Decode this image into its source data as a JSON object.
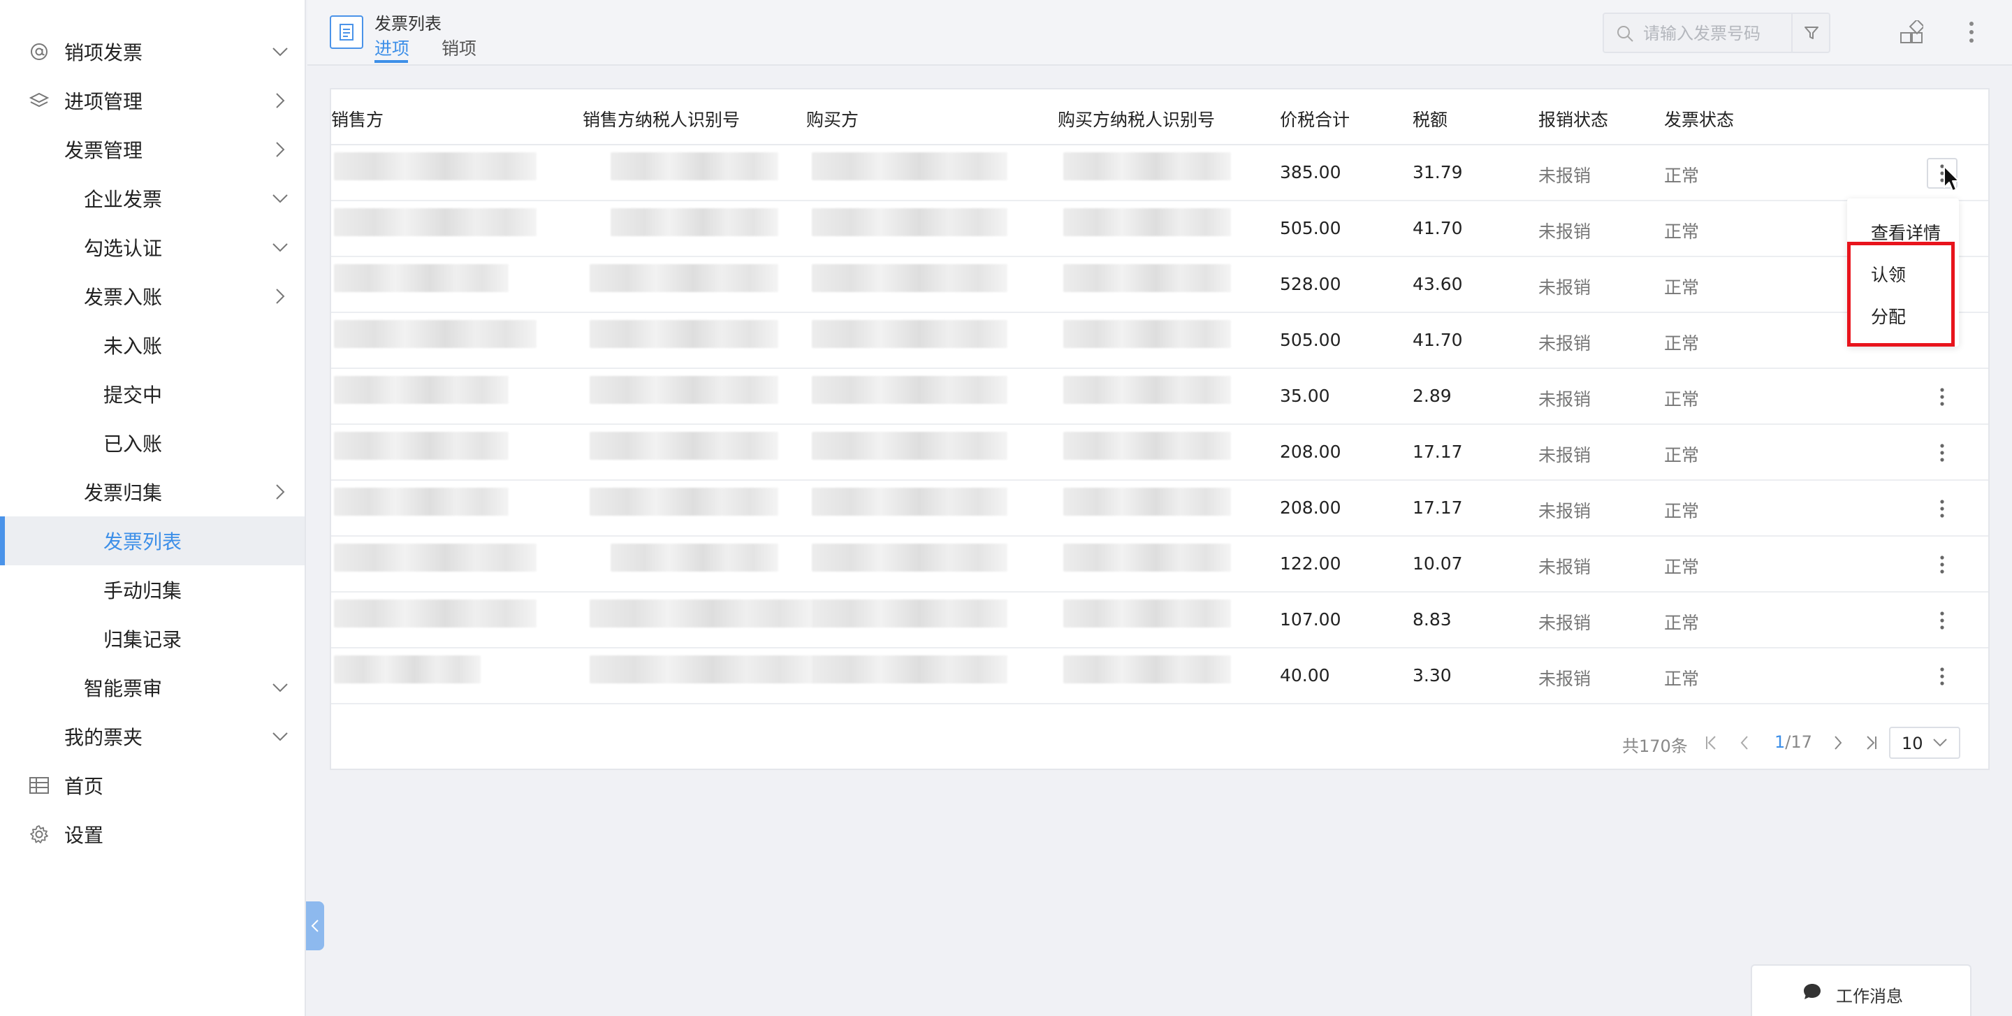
{
  "sidebar": {
    "items": [
      {
        "label": "销项发票",
        "icon": "at-icon",
        "chevron": "down"
      },
      {
        "label": "进项管理",
        "icon": "layers-icon",
        "chevron": "right"
      },
      {
        "label": "发票管理",
        "chevron": "right"
      },
      {
        "label": "企业发票",
        "chevron": "down"
      },
      {
        "label": "勾选认证",
        "chevron": "down"
      },
      {
        "label": "发票入账",
        "chevron": "right"
      },
      {
        "label": "未入账"
      },
      {
        "label": "提交中"
      },
      {
        "label": "已入账"
      },
      {
        "label": "发票归集",
        "chevron": "right"
      },
      {
        "label": "发票列表",
        "active": true
      },
      {
        "label": "手动归集"
      },
      {
        "label": "归集记录"
      },
      {
        "label": "智能票审",
        "chevron": "down"
      },
      {
        "label": "我的票夹",
        "chevron": "down"
      },
      {
        "label": "首页",
        "icon": "table-icon"
      },
      {
        "label": "设置",
        "icon": "gear-icon"
      }
    ]
  },
  "header": {
    "title": "发票列表",
    "tabs": [
      {
        "label": "进项",
        "active": true
      },
      {
        "label": "销项",
        "active": false
      }
    ],
    "search_placeholder": "请输入发票号码"
  },
  "table": {
    "columns": [
      "销售方",
      "销售方纳税人识别号",
      "购买方",
      "购买方纳税人识别号",
      "价税合计",
      "税额",
      "报销状态",
      "发票状态"
    ],
    "rows": [
      {
        "total": "385.00",
        "tax": "31.79",
        "reimburse": "未报销",
        "status": "正常"
      },
      {
        "total": "505.00",
        "tax": "41.70",
        "reimburse": "未报销",
        "status": "正常"
      },
      {
        "total": "528.00",
        "tax": "43.60",
        "reimburse": "未报销",
        "status": "正常"
      },
      {
        "total": "505.00",
        "tax": "41.70",
        "reimburse": "未报销",
        "status": "正常"
      },
      {
        "total": "35.00",
        "tax": "2.89",
        "reimburse": "未报销",
        "status": "正常"
      },
      {
        "total": "208.00",
        "tax": "17.17",
        "reimburse": "未报销",
        "status": "正常"
      },
      {
        "total": "208.00",
        "tax": "17.17",
        "reimburse": "未报销",
        "status": "正常"
      },
      {
        "total": "122.00",
        "tax": "10.07",
        "reimburse": "未报销",
        "status": "正常"
      },
      {
        "total": "107.00",
        "tax": "8.83",
        "reimburse": "未报销",
        "status": "正常"
      },
      {
        "total": "40.00",
        "tax": "3.30",
        "reimburse": "未报销",
        "status": "正常"
      }
    ]
  },
  "row_menu": {
    "items": [
      "查看详情",
      "认领",
      "分配"
    ]
  },
  "pagination": {
    "total": "共170条",
    "current": "1",
    "pages": "/17",
    "page_size": "10"
  },
  "work_message": {
    "label": "工作消息"
  },
  "colors": {
    "accent": "#3d8fe8",
    "highlight": "#e8141c",
    "muted_text": "#777777"
  }
}
